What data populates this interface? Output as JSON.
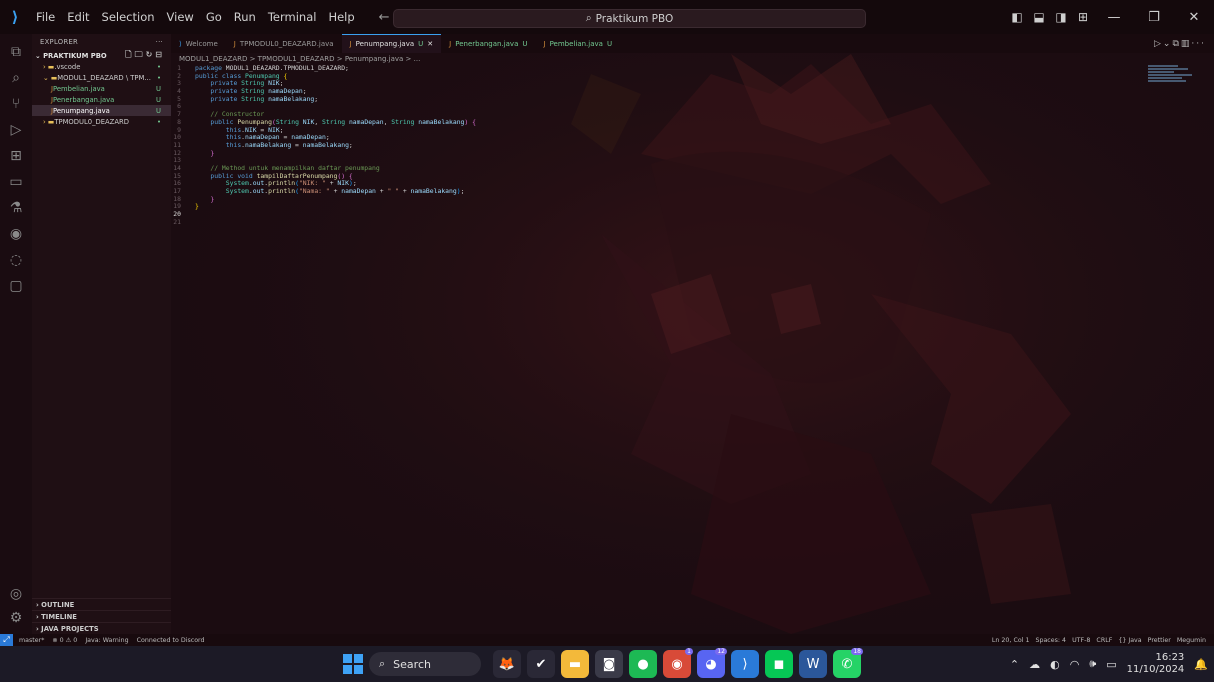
{
  "titlebar": {
    "menu": [
      "File",
      "Edit",
      "Selection",
      "View",
      "Go",
      "Run",
      "Terminal",
      "Help"
    ],
    "search": "Praktikum PBO"
  },
  "activity_icons": [
    "explorer-icon",
    "search-icon",
    "source-control-icon",
    "run-debug-icon",
    "extensions-icon",
    "remote-explorer-icon",
    "testing-icon",
    "copilot-icon",
    "gitlens-icon",
    "chat-icon",
    "accounts-icon",
    "settings-icon"
  ],
  "sidebar": {
    "title": "EXPLORER",
    "dots": "···",
    "project": "PRAKTIKUM PBO",
    "items": [
      {
        "label": ".vscode",
        "badge": "•",
        "indent": 1,
        "type": "folder"
      },
      {
        "label": "MODUL1_DEAZARD \\ TPM...",
        "badge": "•",
        "indent": 1,
        "type": "folder-open"
      },
      {
        "label": "Pembelian.java",
        "badge": "U",
        "indent": 2,
        "type": "java"
      },
      {
        "label": "Penerbangan.java",
        "badge": "U",
        "indent": 2,
        "type": "java"
      },
      {
        "label": "Penumpang.java",
        "badge": "U",
        "indent": 2,
        "type": "java",
        "selected": true
      },
      {
        "label": "TPMODUL0_DEAZARD",
        "badge": "•",
        "indent": 1,
        "type": "folder"
      }
    ],
    "outline": "OUTLINE",
    "timeline": "TIMELINE",
    "java_projects": "JAVA PROJECTS"
  },
  "tabs": [
    {
      "label": "Welcome",
      "badge": "",
      "active": false
    },
    {
      "label": "TPMODUL0_DEAZARD.java",
      "badge": "",
      "active": false
    },
    {
      "label": "Penumpang.java",
      "badge": "U",
      "active": true
    },
    {
      "label": "Penerbangan.java",
      "badge": "U",
      "active": false
    },
    {
      "label": "Pembelian.java",
      "badge": "U",
      "active": false
    }
  ],
  "breadcrumb": "MODUL1_DEAZARD > TPMODUL1_DEAZARD > Penumpang.java > ...",
  "code_lines": [
    [
      [
        "kw",
        "package "
      ],
      [
        "pl",
        "MODUL1_DEAZARD.TPMODUL1_DEAZARD;"
      ]
    ],
    [
      [
        "kw",
        "public class "
      ],
      [
        "ty",
        "Penumpang "
      ],
      [
        "br",
        "{"
      ]
    ],
    [
      [
        "pl",
        "    "
      ],
      [
        "kw",
        "private "
      ],
      [
        "ty",
        "String "
      ],
      [
        "va",
        "NIK"
      ],
      [
        "pl",
        ";"
      ]
    ],
    [
      [
        "pl",
        "    "
      ],
      [
        "kw",
        "private "
      ],
      [
        "ty",
        "String "
      ],
      [
        "va",
        "namaDepan"
      ],
      [
        "pl",
        ";"
      ]
    ],
    [
      [
        "pl",
        "    "
      ],
      [
        "kw",
        "private "
      ],
      [
        "ty",
        "String "
      ],
      [
        "va",
        "namaBelakang"
      ],
      [
        "pl",
        ";"
      ]
    ],
    [],
    [
      [
        "pl",
        "    "
      ],
      [
        "cm",
        "// Constructor"
      ]
    ],
    [
      [
        "pl",
        "    "
      ],
      [
        "kw",
        "public "
      ],
      [
        "fn",
        "Penumpang"
      ],
      [
        "br2",
        "("
      ],
      [
        "ty",
        "String "
      ],
      [
        "va",
        "NIK"
      ],
      [
        "pl",
        ", "
      ],
      [
        "ty",
        "String "
      ],
      [
        "va",
        "namaDepan"
      ],
      [
        "pl",
        ", "
      ],
      [
        "ty",
        "String "
      ],
      [
        "va",
        "namaBelakang"
      ],
      [
        "br2",
        ") "
      ],
      [
        "br2",
        "{"
      ]
    ],
    [
      [
        "pl",
        "        "
      ],
      [
        "kw",
        "this"
      ],
      [
        "pl",
        "."
      ],
      [
        "va",
        "NIK"
      ],
      [
        "pl",
        " = "
      ],
      [
        "va",
        "NIK"
      ],
      [
        "pl",
        ";"
      ]
    ],
    [
      [
        "pl",
        "        "
      ],
      [
        "kw",
        "this"
      ],
      [
        "pl",
        "."
      ],
      [
        "va",
        "namaDepan"
      ],
      [
        "pl",
        " = "
      ],
      [
        "va",
        "namaDepan"
      ],
      [
        "pl",
        ";"
      ]
    ],
    [
      [
        "pl",
        "        "
      ],
      [
        "kw",
        "this"
      ],
      [
        "pl",
        "."
      ],
      [
        "va",
        "namaBelakang"
      ],
      [
        "pl",
        " = "
      ],
      [
        "va",
        "namaBelakang"
      ],
      [
        "pl",
        ";"
      ]
    ],
    [
      [
        "pl",
        "    "
      ],
      [
        "br2",
        "}"
      ]
    ],
    [],
    [
      [
        "pl",
        "    "
      ],
      [
        "cm",
        "// Method untuk menampilkan daftar penumpang"
      ]
    ],
    [
      [
        "pl",
        "    "
      ],
      [
        "kw",
        "public void "
      ],
      [
        "fn",
        "tampilDaftarPenumpang"
      ],
      [
        "br2",
        "() "
      ],
      [
        "br2",
        "{"
      ]
    ],
    [
      [
        "pl",
        "        "
      ],
      [
        "ty",
        "System"
      ],
      [
        "pl",
        "."
      ],
      [
        "va",
        "out"
      ],
      [
        "pl",
        "."
      ],
      [
        "fn",
        "println"
      ],
      [
        "br3",
        "("
      ],
      [
        "st",
        "\"NIK: \""
      ],
      [
        "pl",
        " + "
      ],
      [
        "va",
        "NIK"
      ],
      [
        "br3",
        ")"
      ],
      [
        "pl",
        ";"
      ]
    ],
    [
      [
        "pl",
        "        "
      ],
      [
        "ty",
        "System"
      ],
      [
        "pl",
        "."
      ],
      [
        "va",
        "out"
      ],
      [
        "pl",
        "."
      ],
      [
        "fn",
        "println"
      ],
      [
        "br3",
        "("
      ],
      [
        "st",
        "\"Nama: \""
      ],
      [
        "pl",
        " + "
      ],
      [
        "va",
        "namaDepan"
      ],
      [
        "pl",
        " + "
      ],
      [
        "st",
        "\" \""
      ],
      [
        "pl",
        " + "
      ],
      [
        "va",
        "namaBelakang"
      ],
      [
        "br3",
        ")"
      ],
      [
        "pl",
        ";"
      ]
    ],
    [
      [
        "pl",
        "    "
      ],
      [
        "br2",
        "}"
      ]
    ],
    [
      [
        "br",
        "}"
      ]
    ],
    [],
    []
  ],
  "current_line": 20,
  "statusbar": {
    "left": [
      "master*",
      "⊗ 0 ⚠ 0",
      "Java: Warning",
      "Connected to Discord"
    ],
    "right": [
      "Ln 20, Col 1",
      "Spaces: 4",
      "UTF-8",
      "CRLF",
      "{} Java",
      "Prettier",
      "Megumin"
    ]
  },
  "taskbar": {
    "search": "Search",
    "apps": [
      {
        "name": "pet-app-icon",
        "glyph": "🦊",
        "bg": "#2a2836",
        "count": ""
      },
      {
        "name": "steam-app-icon",
        "glyph": "✔",
        "bg": "#2a2836",
        "count": ""
      },
      {
        "name": "file-explorer-icon",
        "glyph": "▬",
        "bg": "#f3b93a",
        "count": ""
      },
      {
        "name": "camera-app-icon",
        "glyph": "◙",
        "bg": "#3a3a48",
        "count": ""
      },
      {
        "name": "spotify-icon",
        "glyph": "●",
        "bg": "#1db954",
        "count": ""
      },
      {
        "name": "chrome-icon",
        "glyph": "◉",
        "bg": "#d84a38",
        "count": "1"
      },
      {
        "name": "discord-icon",
        "glyph": "◕",
        "bg": "#5865f2",
        "count": "12"
      },
      {
        "name": "vscode-icon",
        "glyph": "⟩",
        "bg": "#2a7ad8",
        "count": ""
      },
      {
        "name": "line-icon",
        "glyph": "◼",
        "bg": "#06c755",
        "count": ""
      },
      {
        "name": "word-icon",
        "glyph": "W",
        "bg": "#2b579a",
        "count": ""
      },
      {
        "name": "whatsapp-icon",
        "glyph": "✆",
        "bg": "#25d366",
        "count": "18"
      }
    ],
    "time": "16:23",
    "date": "11/10/2024"
  }
}
